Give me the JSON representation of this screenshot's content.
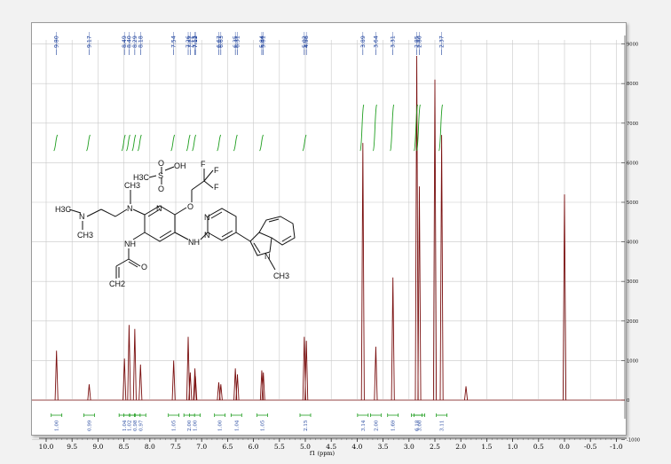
{
  "chart_data": {
    "type": "line",
    "xlabel": "f1 (ppm)",
    "xlim": [
      10.3,
      -1.0
    ],
    "ylim": [
      -1000,
      9500
    ],
    "x_ticks": [
      "10.0",
      "9.5",
      "9.0",
      "8.5",
      "8.0",
      "7.5",
      "7.0",
      "6.5",
      "6.0",
      "5.5",
      "5.0",
      "4.5",
      "4.0",
      "3.5",
      "3.0",
      "2.5",
      "2.0",
      "1.5",
      "1.0",
      "0.5",
      "0.0",
      "-0.5",
      "-1.0"
    ],
    "y_ticks": [
      "-1000",
      "0",
      "1000",
      "2000",
      "3000",
      "4000",
      "5000",
      "6000",
      "7000",
      "8000",
      "9000"
    ],
    "peak_labels": [
      "9.80",
      "9.17",
      "8.49",
      "8.40",
      "8.29",
      "8.18",
      "7.54",
      "7.26",
      "7.22",
      "7.13",
      "7.12",
      "6.67",
      "6.63",
      "6.35",
      "6.31",
      "5.84",
      "5.81",
      "5.02",
      "4.98",
      "3.89",
      "3.64",
      "3.31",
      "2.85",
      "2.80",
      "2.37"
    ],
    "peaks": [
      {
        "x": 9.8,
        "y": 1250
      },
      {
        "x": 9.17,
        "y": 400
      },
      {
        "x": 8.49,
        "y": 1050
      },
      {
        "x": 8.4,
        "y": 1900
      },
      {
        "x": 8.29,
        "y": 1800
      },
      {
        "x": 8.18,
        "y": 900
      },
      {
        "x": 7.54,
        "y": 1000
      },
      {
        "x": 7.26,
        "y": 1600
      },
      {
        "x": 7.22,
        "y": 700
      },
      {
        "x": 7.13,
        "y": 800
      },
      {
        "x": 7.12,
        "y": 600
      },
      {
        "x": 6.67,
        "y": 450
      },
      {
        "x": 6.63,
        "y": 400
      },
      {
        "x": 6.35,
        "y": 800
      },
      {
        "x": 6.31,
        "y": 650
      },
      {
        "x": 5.84,
        "y": 750
      },
      {
        "x": 5.81,
        "y": 700
      },
      {
        "x": 5.02,
        "y": 1600
      },
      {
        "x": 4.98,
        "y": 1500
      },
      {
        "x": 3.89,
        "y": 6500
      },
      {
        "x": 3.64,
        "y": 1350
      },
      {
        "x": 3.31,
        "y": 3100
      },
      {
        "x": 2.85,
        "y": 8700
      },
      {
        "x": 2.8,
        "y": 5400
      },
      {
        "x": 2.5,
        "y": 8100
      },
      {
        "x": 2.37,
        "y": 6700
      },
      {
        "x": 1.9,
        "y": 350
      },
      {
        "x": 0.0,
        "y": 5200
      }
    ],
    "integrals": [
      {
        "x": 9.8,
        "label": "1.00"
      },
      {
        "x": 9.17,
        "label": "0.99"
      },
      {
        "x": 8.49,
        "label": "1.04"
      },
      {
        "x": 8.4,
        "label": "1.02"
      },
      {
        "x": 8.29,
        "label": "0.98"
      },
      {
        "x": 8.18,
        "label": "0.97"
      },
      {
        "x": 7.54,
        "label": "1.05"
      },
      {
        "x": 7.24,
        "label": "2.00"
      },
      {
        "x": 7.13,
        "label": "1.00"
      },
      {
        "x": 6.65,
        "label": "1.00"
      },
      {
        "x": 6.33,
        "label": "1.04"
      },
      {
        "x": 5.83,
        "label": "1.05"
      },
      {
        "x": 5.0,
        "label": "2.15"
      },
      {
        "x": 3.89,
        "label": "3.14"
      },
      {
        "x": 3.64,
        "label": "2.00"
      },
      {
        "x": 3.31,
        "label": "1.69"
      },
      {
        "x": 2.85,
        "label": "6.18"
      },
      {
        "x": 2.8,
        "label": "3.00"
      },
      {
        "x": 2.37,
        "label": "3.11"
      }
    ],
    "integral_curves": [
      9.8,
      9.17,
      8.49,
      8.4,
      8.29,
      8.18,
      7.54,
      7.24,
      7.13,
      6.65,
      6.33,
      5.83,
      5.0,
      3.89,
      3.64,
      3.31,
      2.85,
      2.8,
      2.37
    ],
    "colors": {
      "spectrum": "#7a0f0f",
      "integral": "#1f9e1f",
      "labels": "#1a3e9a"
    }
  },
  "molecule": {
    "labels": {
      "h3c_left": "H3C",
      "n_amine": "N",
      "ch3_amine": "CH3",
      "n_pyr_amine": "N",
      "ch3_nme": "CH3",
      "n_py_ring": "N",
      "o_ether": "O",
      "f1": "F",
      "f2": "F",
      "f3": "F",
      "s_atom": "S",
      "oh": "OH",
      "o_s1": "O",
      "o_s2": "O",
      "h3c_ms": "H3C",
      "nh_acryl": "NH",
      "o_amide": "O",
      "ch2": "CH2",
      "nh_link": "NH",
      "n_pm1": "N",
      "n_pm2": "N",
      "n_indole": "N",
      "ch3_indole": "CH3"
    }
  }
}
